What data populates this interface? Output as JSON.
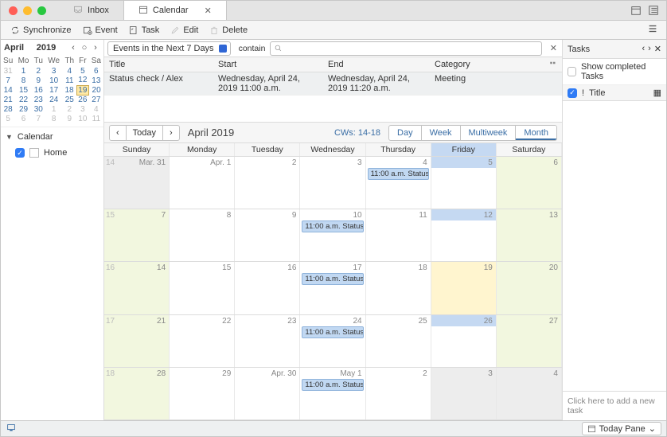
{
  "tabs": {
    "inbox": "Inbox",
    "calendar": "Calendar"
  },
  "toolbar": {
    "sync": "Synchronize",
    "event": "Event",
    "task": "Task",
    "edit": "Edit",
    "delete": "Delete"
  },
  "minical": {
    "month": "April",
    "year": "2019",
    "dows": [
      "Su",
      "Mo",
      "Tu",
      "We",
      "Th",
      "Fr",
      "Sa"
    ],
    "rows": [
      [
        {
          "d": "31",
          "dim": true
        },
        {
          "d": "1"
        },
        {
          "d": "2"
        },
        {
          "d": "3"
        },
        {
          "d": "4"
        },
        {
          "d": "5"
        },
        {
          "d": "6"
        }
      ],
      [
        {
          "d": "7"
        },
        {
          "d": "8"
        },
        {
          "d": "9"
        },
        {
          "d": "10"
        },
        {
          "d": "11"
        },
        {
          "d": "12"
        },
        {
          "d": "13"
        }
      ],
      [
        {
          "d": "14"
        },
        {
          "d": "15"
        },
        {
          "d": "16"
        },
        {
          "d": "17"
        },
        {
          "d": "18"
        },
        {
          "d": "19",
          "today": true
        },
        {
          "d": "20"
        }
      ],
      [
        {
          "d": "21"
        },
        {
          "d": "22"
        },
        {
          "d": "23"
        },
        {
          "d": "24"
        },
        {
          "d": "25"
        },
        {
          "d": "26"
        },
        {
          "d": "27"
        }
      ],
      [
        {
          "d": "28"
        },
        {
          "d": "29"
        },
        {
          "d": "30"
        },
        {
          "d": "1",
          "dim": true
        },
        {
          "d": "2",
          "dim": true
        },
        {
          "d": "3",
          "dim": true
        },
        {
          "d": "4",
          "dim": true
        }
      ],
      [
        {
          "d": "5",
          "dim": true
        },
        {
          "d": "6",
          "dim": true
        },
        {
          "d": "7",
          "dim": true
        },
        {
          "d": "8",
          "dim": true
        },
        {
          "d": "9",
          "dim": true
        },
        {
          "d": "10",
          "dim": true
        },
        {
          "d": "11",
          "dim": true
        }
      ]
    ]
  },
  "sidebar": {
    "calendar_header": "Calendar",
    "home": "Home"
  },
  "search": {
    "filter": "Events in the Next 7 Days",
    "op": "contain"
  },
  "eventlist": {
    "cols": {
      "title": "Title",
      "start": "Start",
      "end": "End",
      "category": "Category"
    },
    "rows": [
      {
        "title": "Status check / Alex",
        "start": "Wednesday, April 24, 2019 11:00 a.m.",
        "end": "Wednesday, April 24, 2019 11:20 a.m.",
        "category": "Meeting"
      }
    ]
  },
  "calnav": {
    "today": "Today",
    "month_label": "April 2019",
    "cw": "CWs: 14-18",
    "views": {
      "day": "Day",
      "week": "Week",
      "multi": "Multiweek",
      "month": "Month"
    }
  },
  "dayheaders": [
    "Sunday",
    "Monday",
    "Tuesday",
    "Wednesday",
    "Thursday",
    "Friday",
    "Saturday"
  ],
  "weeks": [
    {
      "wk": "14",
      "days": [
        {
          "lbl": "Mar. 31",
          "dim": true
        },
        {
          "lbl": "Apr. 1"
        },
        {
          "lbl": "2"
        },
        {
          "lbl": "3"
        },
        {
          "lbl": "4",
          "ev": "11:00 a.m. Status ..."
        },
        {
          "lbl": "5",
          "fri": true
        },
        {
          "lbl": "6",
          "we": true
        }
      ]
    },
    {
      "wk": "15",
      "days": [
        {
          "lbl": "7",
          "we": true
        },
        {
          "lbl": "8"
        },
        {
          "lbl": "9"
        },
        {
          "lbl": "10",
          "ev": "11:00 a.m. Status ..."
        },
        {
          "lbl": "11"
        },
        {
          "lbl": "12",
          "fri": true
        },
        {
          "lbl": "13",
          "we": true
        }
      ]
    },
    {
      "wk": "16",
      "days": [
        {
          "lbl": "14",
          "we": true
        },
        {
          "lbl": "15"
        },
        {
          "lbl": "16"
        },
        {
          "lbl": "17",
          "ev": "11:00 a.m. Status ..."
        },
        {
          "lbl": "18"
        },
        {
          "lbl": "19",
          "today": true,
          "fri": true
        },
        {
          "lbl": "20",
          "we": true
        }
      ]
    },
    {
      "wk": "17",
      "days": [
        {
          "lbl": "21",
          "we": true
        },
        {
          "lbl": "22"
        },
        {
          "lbl": "23"
        },
        {
          "lbl": "24",
          "ev": "11:00 a.m. Status ..."
        },
        {
          "lbl": "25"
        },
        {
          "lbl": "26",
          "fri": true
        },
        {
          "lbl": "27",
          "we": true
        }
      ]
    },
    {
      "wk": "18",
      "days": [
        {
          "lbl": "28",
          "we": true
        },
        {
          "lbl": "29"
        },
        {
          "lbl": "Apr. 30"
        },
        {
          "lbl": "May 1",
          "ev": "11:00 a.m. Status ..."
        },
        {
          "lbl": "2"
        },
        {
          "lbl": "3",
          "fri": true,
          "dim": true
        },
        {
          "lbl": "4",
          "we": true,
          "dim": true
        }
      ]
    }
  ],
  "tasks": {
    "header": "Tasks",
    "show_completed": "Show completed Tasks",
    "col_title": "Title",
    "new_task": "Click here to add a new task"
  },
  "status": {
    "today_pane": "Today Pane"
  }
}
